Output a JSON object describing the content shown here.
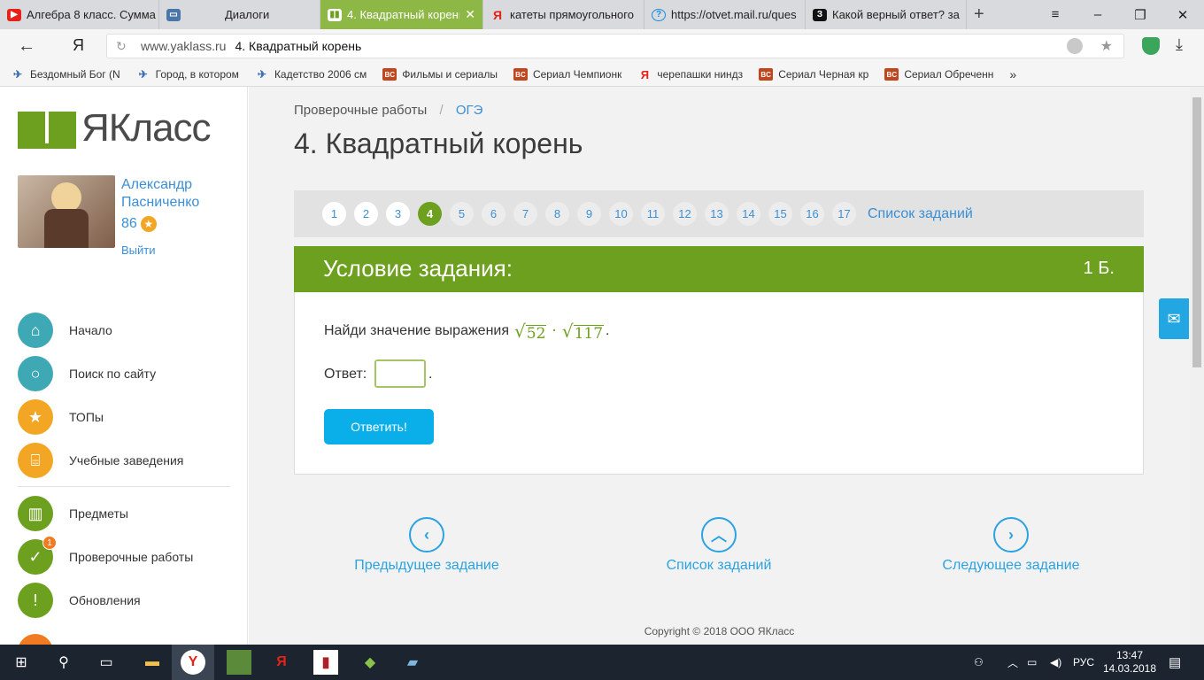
{
  "browser": {
    "tabs": [
      {
        "title": "Алгебра 8 класс. Сумма",
        "icon": "youtube-icon",
        "color": "#e62117"
      },
      {
        "title": "Диалоги",
        "icon": "vk-chat-icon",
        "color": "#4a76a8"
      },
      {
        "title": "4. Квадратный корень",
        "icon": "yaklass-icon",
        "color": "#6da01e"
      },
      {
        "title": "катеты прямоугольного",
        "icon": "yandex-icon",
        "color": "#e62117"
      },
      {
        "title": "https://otvet.mail.ru/ques",
        "icon": "mail-otvet-icon",
        "color": "#168de2"
      },
      {
        "title": "Какой верный ответ? за",
        "icon": "znanija-icon",
        "color": "#111111"
      }
    ],
    "new_tab": "+",
    "menu": "≡",
    "minimize": "–",
    "restore": "❐",
    "close": "✕",
    "back": "←",
    "yandex_logo": "Я",
    "url_host": "www.yaklass.ru",
    "url_title": "4. Квадратный корень",
    "bookmarks": [
      {
        "title": "Бездомный Бог (N",
        "icon": "bird-icon"
      },
      {
        "title": "Город, в котором",
        "icon": "bird-icon"
      },
      {
        "title": "Кадетство 2006 см",
        "icon": "bird-icon"
      },
      {
        "title": "Фильмы и сериалы",
        "icon": "bc-icon"
      },
      {
        "title": "Сериал Чемпионк",
        "icon": "bc-icon"
      },
      {
        "title": "черепашки ниндз",
        "icon": "yandex-icon"
      },
      {
        "title": "Сериал Черная кр",
        "icon": "bc-icon"
      },
      {
        "title": "Сериал Обреченн",
        "icon": "bc-icon"
      }
    ],
    "bookmarks_more": "»"
  },
  "sidebar": {
    "logo_text": "ЯКласс",
    "user_name": "Александр Пасниченко",
    "points": "86",
    "logout": "Выйти",
    "nav": [
      {
        "label": "Начало",
        "icon": "home-icon",
        "color": "#3fa8b5"
      },
      {
        "label": "Поиск по сайту",
        "icon": "search-icon",
        "color": "#3fa8b5"
      },
      {
        "label": "ТОПы",
        "icon": "star-icon",
        "color": "#f2a623"
      },
      {
        "label": "Учебные заведения",
        "icon": "institution-icon",
        "color": "#f2a623"
      },
      {
        "label": "Предметы",
        "icon": "book-icon",
        "color": "#6da01e"
      },
      {
        "label": "Проверочные работы",
        "icon": "check-icon",
        "color": "#6da01e",
        "badge": "1"
      },
      {
        "label": "Обновления",
        "icon": "exclamation-icon",
        "color": "#6da01e"
      }
    ]
  },
  "main": {
    "breadcrumb": [
      "Проверочные работы",
      "ОГЭ"
    ],
    "breadcrumb_sep": "/",
    "title": "4. Квадратный корень",
    "pages": [
      "1",
      "2",
      "3",
      "4",
      "5",
      "6",
      "7",
      "8",
      "9",
      "10",
      "11",
      "12",
      "13",
      "14",
      "15",
      "16",
      "17"
    ],
    "current_page": "4",
    "task_list_link": "Список заданий",
    "task_header": "Условие задания:",
    "task_points": "1 Б.",
    "question_text": "Найди значение выражения",
    "formula": {
      "a": "52",
      "op": "·",
      "b": "117",
      "end": "."
    },
    "answer_label": "Ответ:",
    "answer_value": "",
    "answer_dot": ".",
    "submit_label": "Ответить!",
    "prev_label": "Предыдущее задание",
    "list_label": "Список заданий",
    "next_label": "Следующее задание",
    "copyright": "Copyright © 2018 ООО ЯКласс"
  },
  "taskbar": {
    "lang": "РУС",
    "time": "13:47",
    "date": "14.03.2018"
  }
}
